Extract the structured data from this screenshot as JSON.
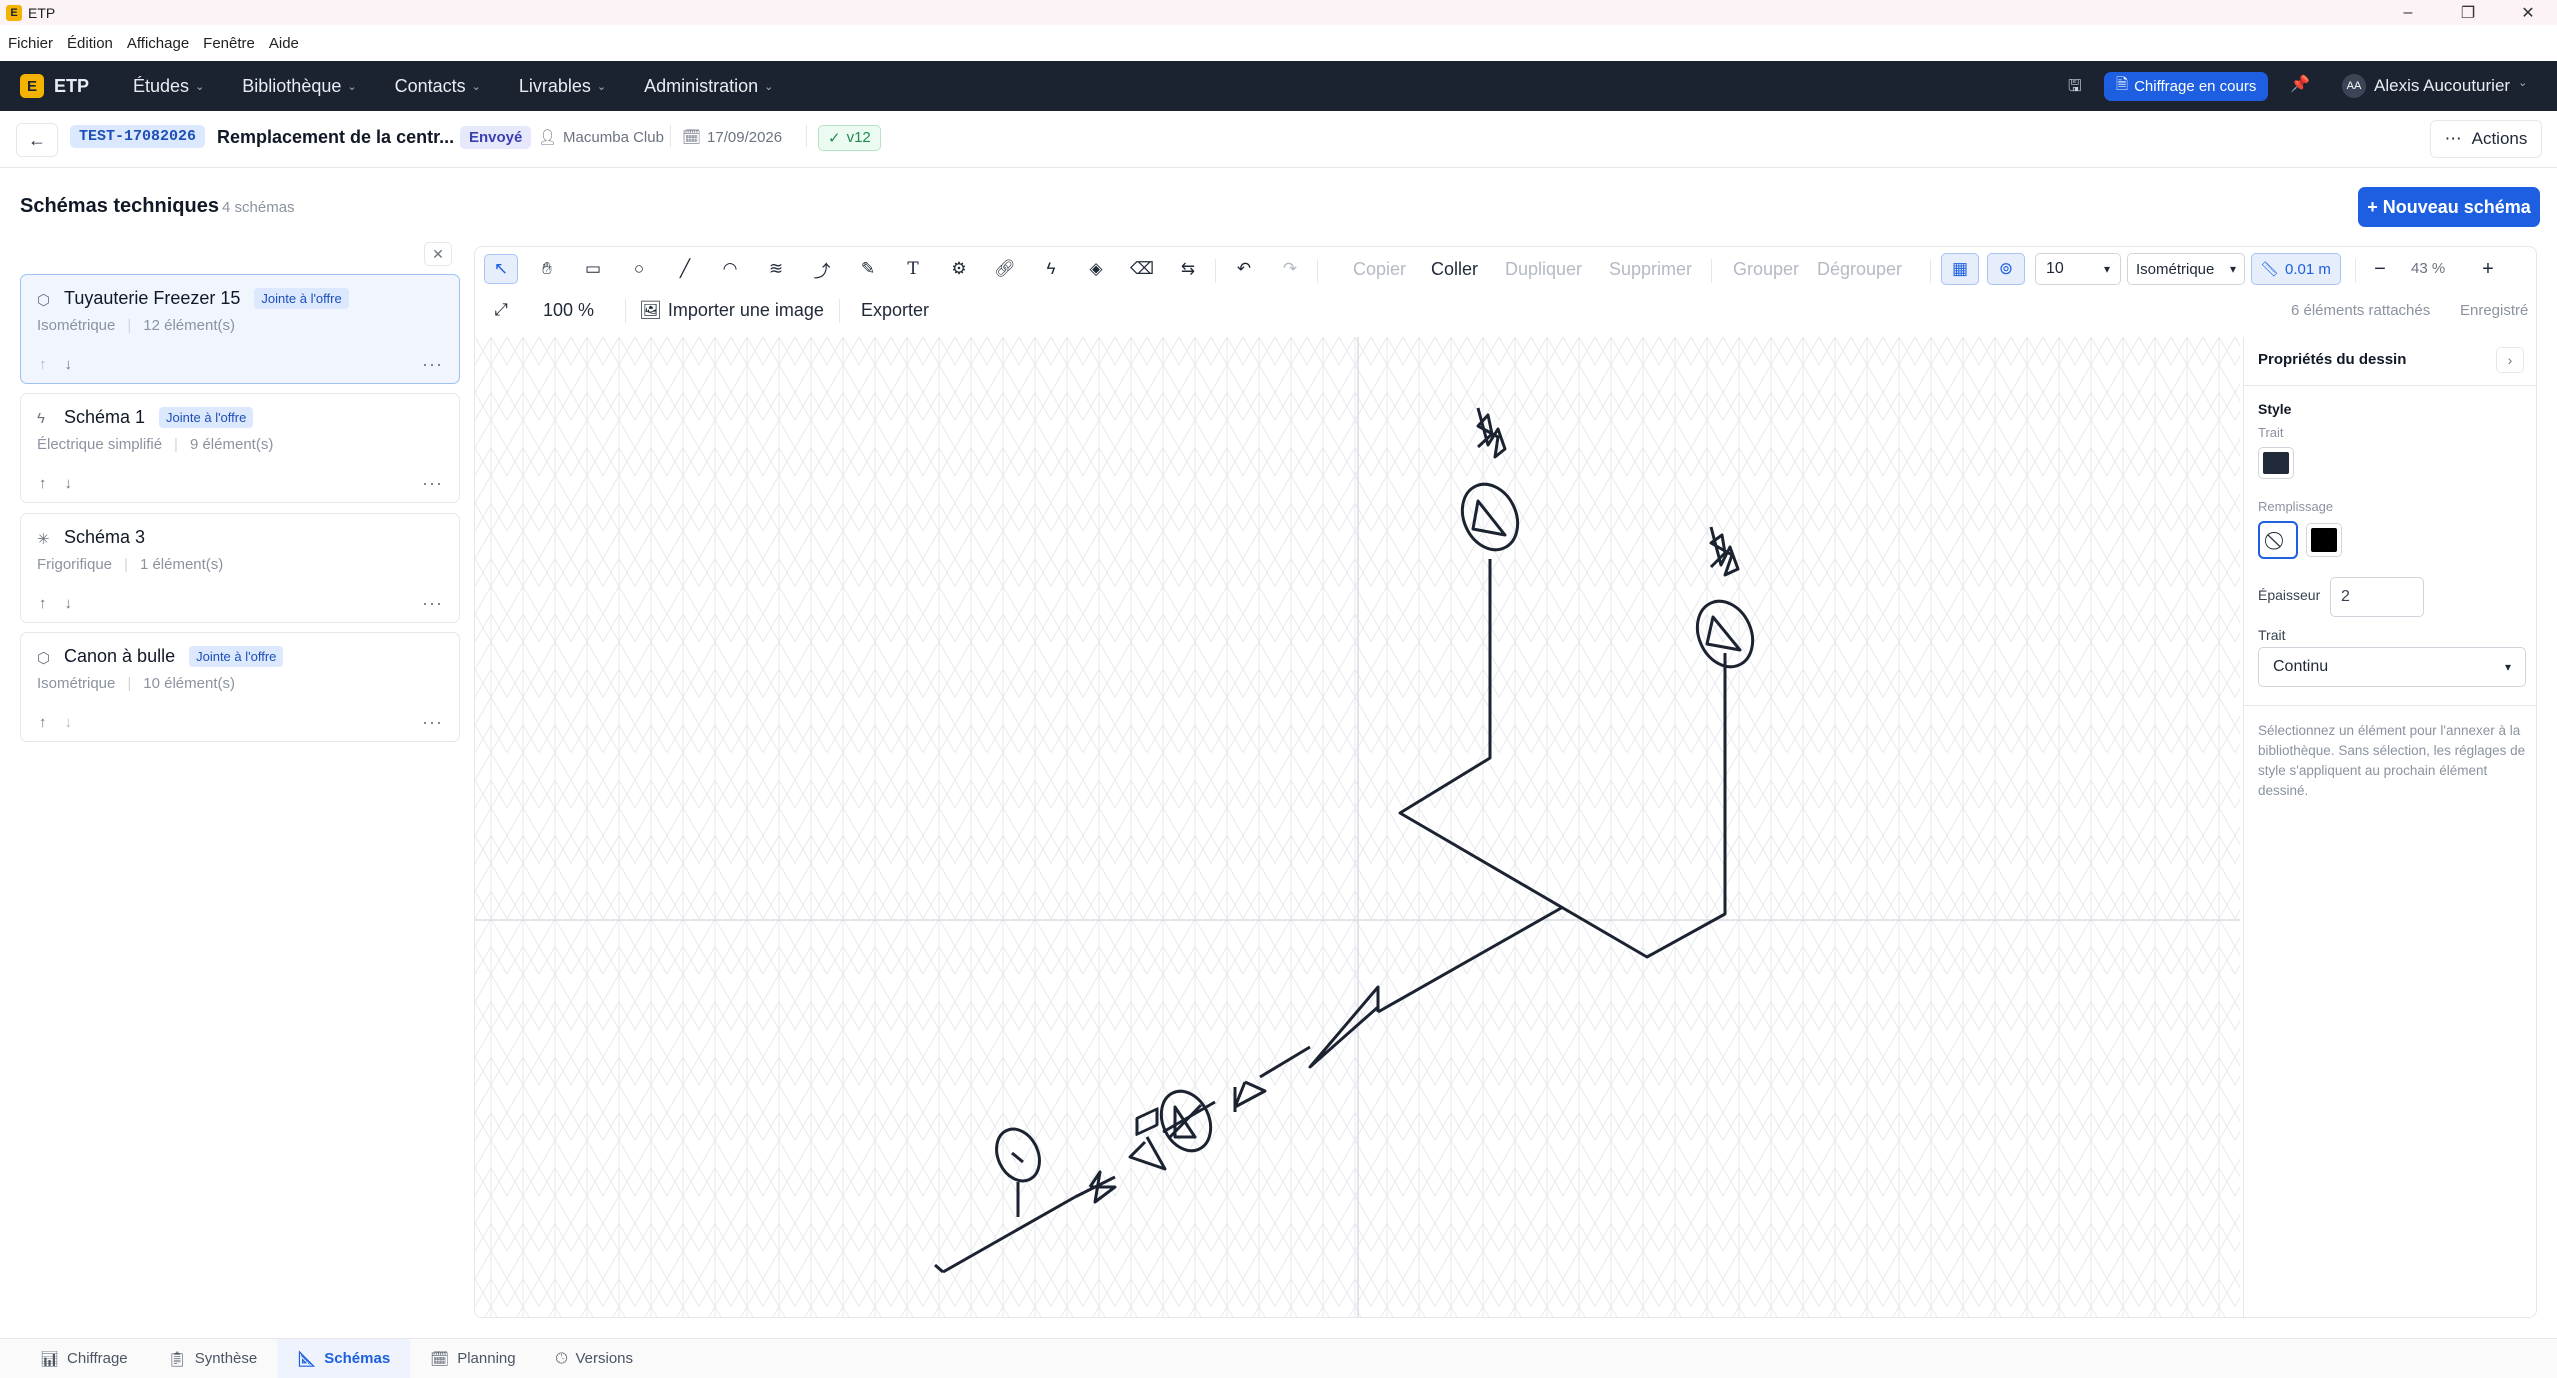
{
  "os": {
    "app_title": "ETP",
    "logo_letter": "E"
  },
  "menubar": [
    "Fichier",
    "Édition",
    "Affichage",
    "Fenêtre",
    "Aide"
  ],
  "nav": {
    "brand": "ETP",
    "items": [
      "Études",
      "Bibliothèque",
      "Contacts",
      "Livrables",
      "Administration"
    ],
    "status_button": "Chiffrage en cours",
    "user_initials": "AA",
    "user_name": "Alexis Aucouturier"
  },
  "subheader": {
    "ref": "TEST-17082026",
    "title": "Remplacement de la centr...",
    "status": "Envoyé",
    "client": "Macumba Club",
    "date": "17/09/2026",
    "version": "v12",
    "actions_label": "Actions"
  },
  "page": {
    "title": "Schémas techniques",
    "count": "4 schémas",
    "new_button": "+ Nouveau schéma"
  },
  "schemas": [
    {
      "name": "Tuyauterie Freezer 15",
      "tag": "Jointe à l'offre",
      "type": "Isométrique",
      "elements": "12 élément(s)",
      "icon": "cube-icon"
    },
    {
      "name": "Schéma 1",
      "tag": "Jointe à l'offre",
      "type": "Électrique simplifié",
      "elements": "9 élément(s)",
      "icon": "bolt-icon"
    },
    {
      "name": "Schéma 3",
      "tag": "",
      "type": "Frigorifique",
      "elements": "1 élément(s)",
      "icon": "snowflake-icon"
    },
    {
      "name": "Canon à bulle",
      "tag": "Jointe à l'offre",
      "type": "Isométrique",
      "elements": "10 élément(s)",
      "icon": "cube-icon"
    }
  ],
  "toolbar": {
    "copy": "Copier",
    "paste": "Coller",
    "duplicate": "Dupliquer",
    "delete": "Supprimer",
    "group": "Grouper",
    "ungroup": "Dégrouper",
    "stroke_size": "10",
    "projection": "Isométrique",
    "snap": "0.01 m",
    "zoom": "43 %",
    "fit_zoom": "100 %",
    "import_image": "Importer une image",
    "export": "Exporter",
    "attached": "6 éléments rattachés",
    "saved": "Enregistré"
  },
  "panel": {
    "title": "Propriétés du dessin",
    "style": "Style",
    "stroke_label": "Trait",
    "fill_label": "Remplissage",
    "thickness_label": "Épaisseur",
    "thickness_value": "2",
    "line_label": "Trait",
    "line_value": "Continu",
    "help": "Sélectionnez un élément pour l'annexer à la bibliothèque. Sans sélection, les réglages de style s'appliquent au prochain élément dessiné.",
    "stroke_color": "#1f2937",
    "fill_color": "#000000"
  },
  "bottom_tabs": [
    "Chiffrage",
    "Synthèse",
    "Schémas",
    "Planning",
    "Versions"
  ]
}
